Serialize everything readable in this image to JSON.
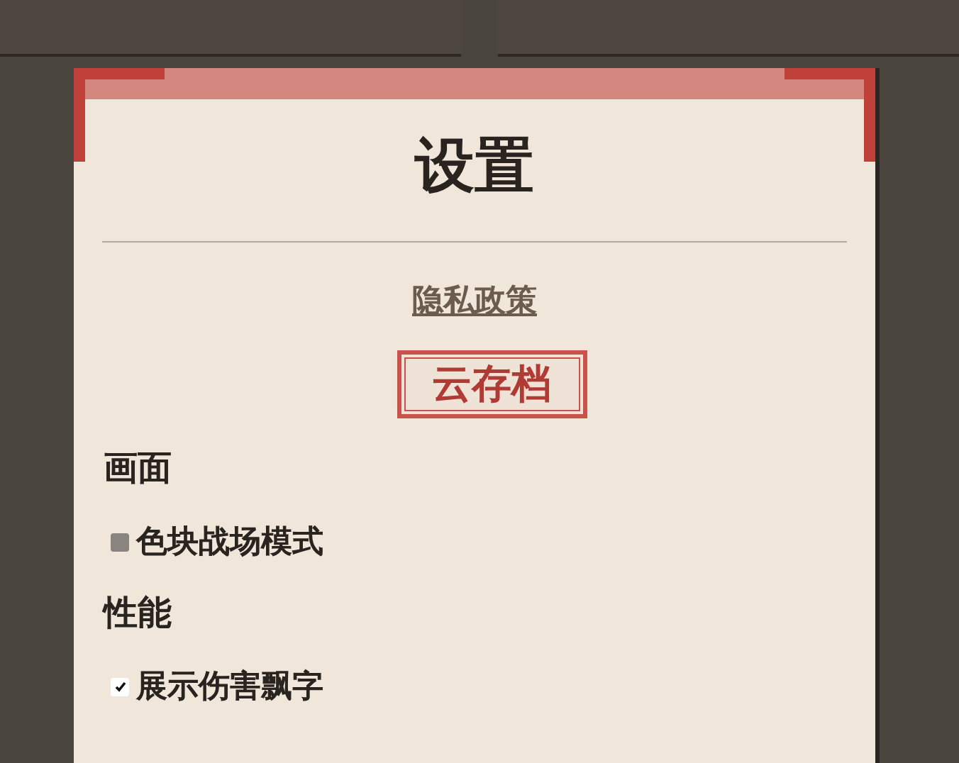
{
  "dialog": {
    "title": "设置",
    "privacy_link": "隐私政策",
    "cloud_save_button": "云存档",
    "sections": [
      {
        "heading": "画面",
        "options": [
          {
            "label": "色块战场模式",
            "checked": false
          }
        ]
      },
      {
        "heading": "性能",
        "options": [
          {
            "label": "展示伤害飘字",
            "checked": true
          }
        ]
      }
    ]
  }
}
